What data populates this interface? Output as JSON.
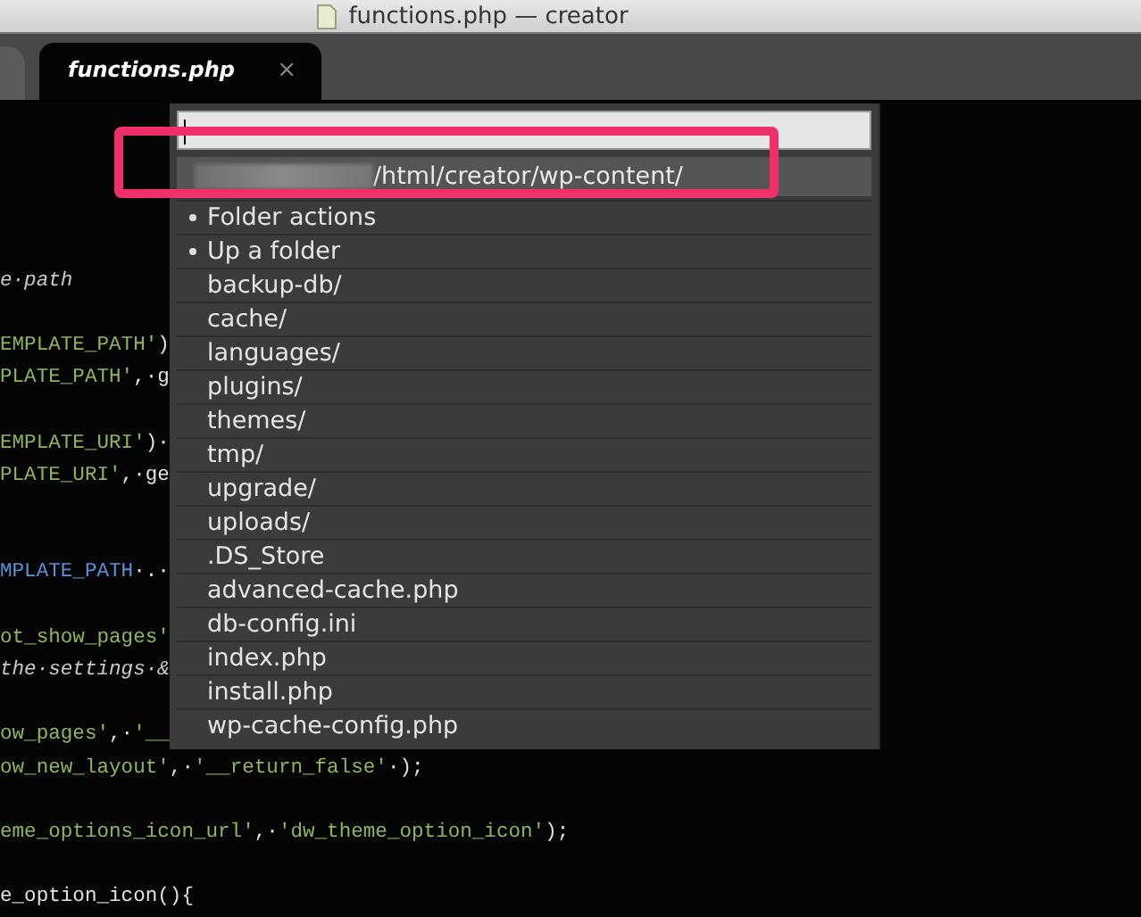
{
  "window": {
    "title": "functions.php — creator"
  },
  "tabs": [
    {
      "label": "functions.php",
      "selected": true,
      "close": "×"
    }
  ],
  "code_lines": [
    {
      "kind": "blank"
    },
    {
      "kind": "blank"
    },
    {
      "kind": "blank"
    },
    {
      "kind": "blank"
    },
    {
      "kind": "code",
      "segments": [
        {
          "t": "e·path",
          "kind": "comment"
        }
      ]
    },
    {
      "kind": "blank"
    },
    {
      "kind": "code",
      "segments": [
        {
          "t": "EMPLATE_PATH'",
          "kind": "string"
        },
        {
          "t": ")",
          "kind": "plain"
        }
      ]
    },
    {
      "kind": "code",
      "segments": [
        {
          "t": "PLATE_PATH'",
          "kind": "string"
        },
        {
          "t": ",·g",
          "kind": "plain"
        }
      ]
    },
    {
      "kind": "blank"
    },
    {
      "kind": "code",
      "segments": [
        {
          "t": "EMPLATE_URI'",
          "kind": "string"
        },
        {
          "t": ")·",
          "kind": "plain"
        }
      ]
    },
    {
      "kind": "code",
      "segments": [
        {
          "t": "PLATE_URI'",
          "kind": "string"
        },
        {
          "t": ",·ge",
          "kind": "plain"
        }
      ]
    },
    {
      "kind": "blank"
    },
    {
      "kind": "blank"
    },
    {
      "kind": "code",
      "segments": [
        {
          "t": "MPLATE_PATH",
          "kind": "constant"
        },
        {
          "t": "·.·",
          "kind": "plain"
        }
      ]
    },
    {
      "kind": "blank"
    },
    {
      "kind": "code",
      "segments": [
        {
          "t": "ot_show_pages'",
          "kind": "string"
        }
      ]
    },
    {
      "kind": "code",
      "segments": [
        {
          "t": "the·settings·&",
          "kind": "comment"
        }
      ]
    },
    {
      "kind": "blank"
    },
    {
      "kind": "code",
      "segments": [
        {
          "t": "ow_pages'",
          "kind": "string"
        },
        {
          "t": ",·",
          "kind": "plain"
        },
        {
          "t": "'__",
          "kind": "string"
        }
      ]
    },
    {
      "kind": "code",
      "segments": [
        {
          "t": "ow_new_layout'",
          "kind": "string"
        },
        {
          "t": ",·",
          "kind": "plain"
        },
        {
          "t": "'__return_false'",
          "kind": "string"
        },
        {
          "t": "·);",
          "kind": "plain"
        }
      ]
    },
    {
      "kind": "blank"
    },
    {
      "kind": "code",
      "segments": [
        {
          "t": "eme_options_icon_url'",
          "kind": "string"
        },
        {
          "t": ",·",
          "kind": "plain"
        },
        {
          "t": "'dw_theme_option_icon'",
          "kind": "string"
        },
        {
          "t": ");",
          "kind": "plain"
        }
      ]
    },
    {
      "kind": "blank"
    },
    {
      "kind": "code",
      "segments": [
        {
          "t": "e_option_icon(){",
          "kind": "plain"
        }
      ]
    }
  ],
  "palette": {
    "path": "/html/creator/wp-content/",
    "items": [
      {
        "label": "Folder actions",
        "kind": "action"
      },
      {
        "label": "Up a folder",
        "kind": "action"
      },
      {
        "label": "backup-db/",
        "kind": "entry"
      },
      {
        "label": "cache/",
        "kind": "entry"
      },
      {
        "label": "languages/",
        "kind": "entry"
      },
      {
        "label": "plugins/",
        "kind": "entry"
      },
      {
        "label": "themes/",
        "kind": "entry"
      },
      {
        "label": "tmp/",
        "kind": "entry"
      },
      {
        "label": "upgrade/",
        "kind": "entry"
      },
      {
        "label": "uploads/",
        "kind": "entry"
      },
      {
        "label": ".DS_Store",
        "kind": "entry"
      },
      {
        "label": "advanced-cache.php",
        "kind": "entry"
      },
      {
        "label": "db-config.ini",
        "kind": "entry"
      },
      {
        "label": "index.php",
        "kind": "entry"
      },
      {
        "label": "install.php",
        "kind": "entry"
      },
      {
        "label": "wp-cache-config.php",
        "kind": "entry"
      }
    ]
  }
}
